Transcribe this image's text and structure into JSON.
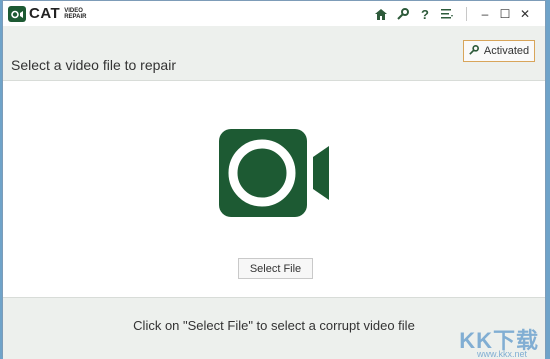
{
  "app": {
    "logo_main": "CAT",
    "logo_sub_line1": "VIDEO",
    "logo_sub_line2": "REPAIR"
  },
  "titlebar": {
    "icons": [
      "home-icon",
      "key-icon",
      "help-icon",
      "menu-icon"
    ],
    "window_controls": [
      "minimize",
      "maximize",
      "close"
    ],
    "help_glyph": "?",
    "minimize_glyph": "–",
    "maximize_glyph": "☐",
    "close_glyph": "✕"
  },
  "header": {
    "title": "Select a video file to repair",
    "activated_label": "Activated"
  },
  "main": {
    "select_button_label": "Select File"
  },
  "footer": {
    "instruction": "Click on \"Select File\" to select a corrupt video file"
  },
  "watermark": {
    "text": "KK下载",
    "url": "www.kkx.net"
  },
  "colors": {
    "brand_green": "#1d5a33",
    "accent_orange": "#d8a55a"
  }
}
